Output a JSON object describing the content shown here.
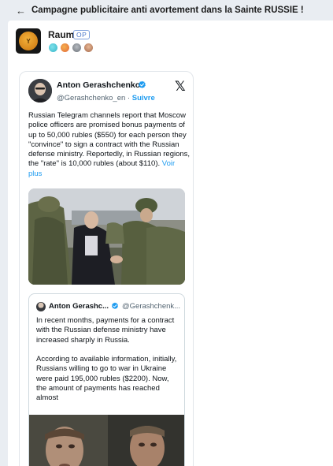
{
  "header": {
    "title": "Campagne publicitaire anti avortement dans la Sainte RUSSIE !"
  },
  "post": {
    "username": "Raum",
    "op_badge": "OP",
    "reactions": [
      {
        "icon": "globe-reaction-icon",
        "color": "#35b6c9"
      },
      {
        "icon": "face-reaction-icon",
        "color": "#e2683a"
      },
      {
        "icon": "avatar-reaction-icon-1",
        "color": "#8a8f96"
      },
      {
        "icon": "avatar-reaction-icon-2",
        "color": "#c98c6a"
      }
    ]
  },
  "tweet": {
    "author_name": "Anton Gerashchenko",
    "handle": "@Gerashchenko_en",
    "separator": " · ",
    "follow_label": "Suivre",
    "body": "Russian Telegram channels report that Moscow police officers are promised bonus payments of up to 50,000 rubles ($550) for each person they \"convince\" to sign a contract with the Russian defense ministry. Reportedly, in Russian regions, the \"rate\" is 10,000 rubles (about $110).",
    "read_more": "Voir plus",
    "quote": {
      "author_name": "Anton Gerashc...",
      "handle": "@Gerashchenk...",
      "paragraph1": "In recent months, payments for a contract with the  Russian defense ministry have increased sharply in Russia.",
      "paragraph2": "According to available information, initially, Russians willing to go to war in Ukraine were paid 195,000 rubles ($2200). Now, the amount of payments has reached almost"
    }
  },
  "colors": {
    "background": "#e9edf2",
    "link": "#1d9bf0",
    "verified": "#1d9bf0",
    "op_badge": "#4a76c9"
  }
}
